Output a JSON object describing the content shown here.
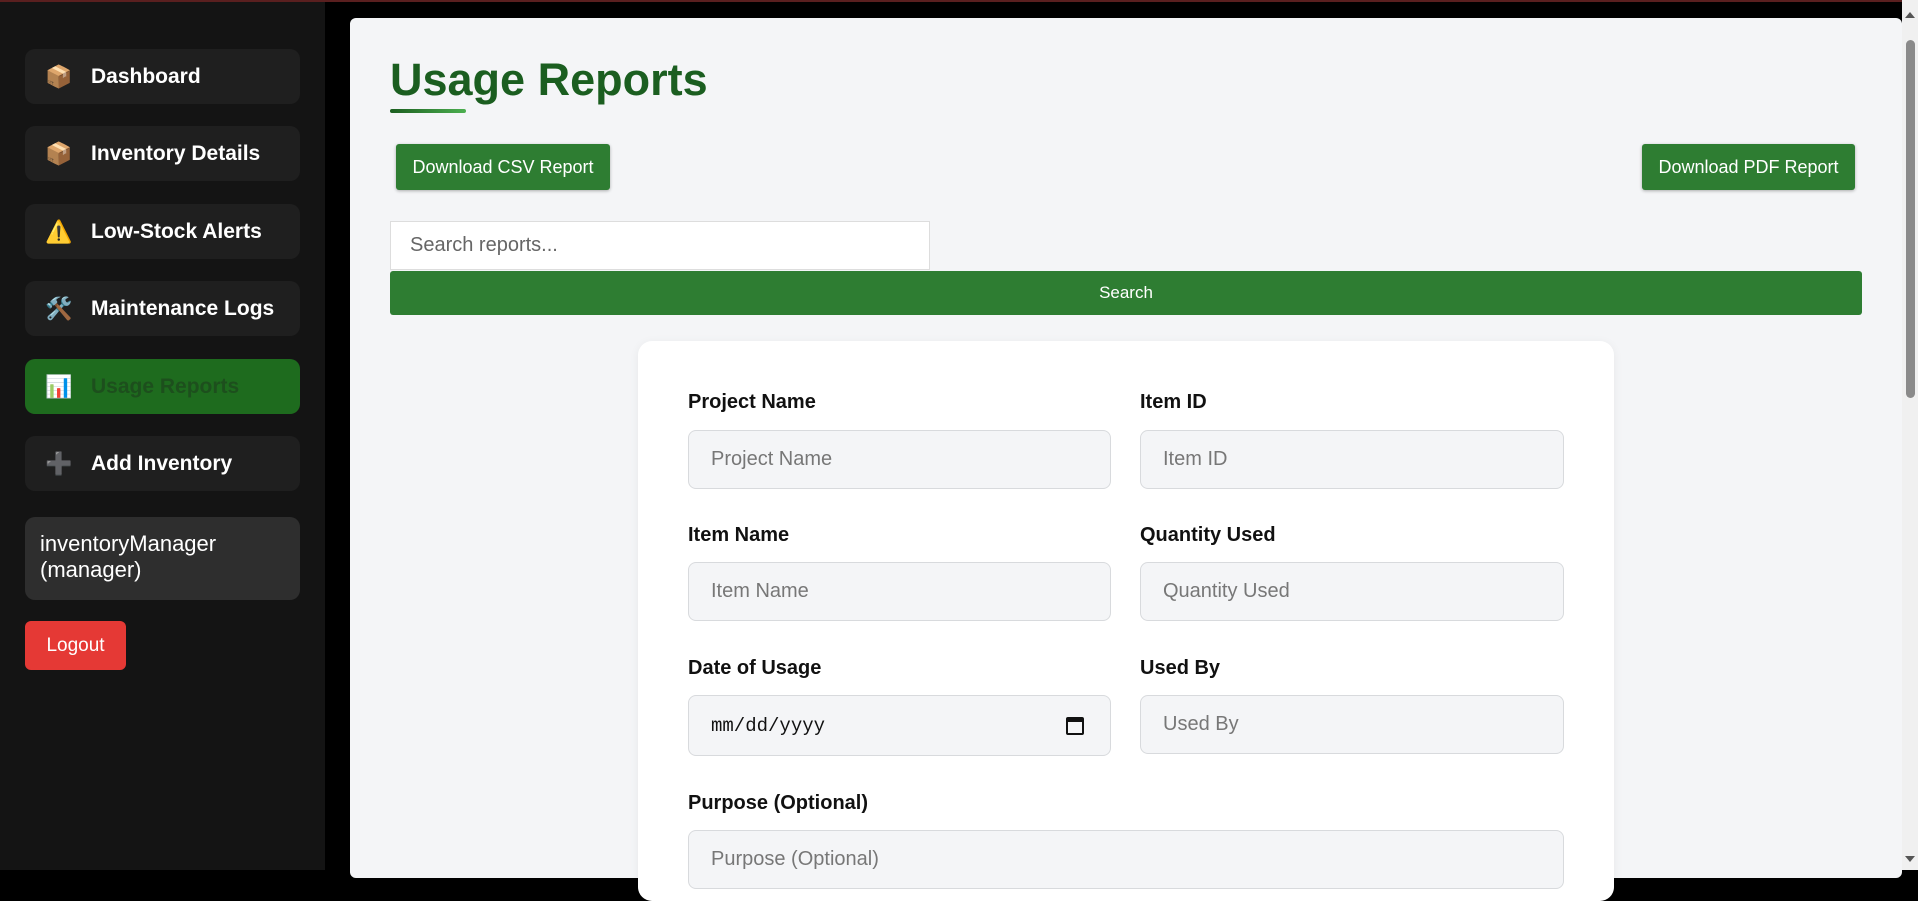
{
  "sidebar": {
    "items": [
      {
        "label": "Dashboard",
        "icon": "📦"
      },
      {
        "label": "Inventory Details",
        "icon": "📦"
      },
      {
        "label": "Low-Stock Alerts",
        "icon": "⚠️"
      },
      {
        "label": "Maintenance Logs",
        "icon": "🛠️"
      },
      {
        "label": "Usage Reports",
        "icon": "📊"
      },
      {
        "label": "Add Inventory",
        "icon": "➕"
      }
    ],
    "user_line1": "inventoryManager",
    "user_line2": "(manager)",
    "logout_label": "Logout"
  },
  "main": {
    "title": "Usage Reports",
    "download_csv_label": "Download CSV Report",
    "download_pdf_label": "Download PDF Report",
    "search_placeholder": "Search reports...",
    "search_button_label": "Search"
  },
  "form": {
    "project_name": {
      "label": "Project Name",
      "placeholder": "Project Name"
    },
    "item_id": {
      "label": "Item ID",
      "placeholder": "Item ID"
    },
    "item_name": {
      "label": "Item Name",
      "placeholder": "Item Name"
    },
    "quantity_used": {
      "label": "Quantity Used",
      "placeholder": "Quantity Used"
    },
    "date_of_usage": {
      "label": "Date of Usage",
      "value": "mm/dd/yyyy"
    },
    "used_by": {
      "label": "Used By",
      "placeholder": "Used By"
    },
    "purpose": {
      "label": "Purpose (Optional)",
      "placeholder": "Purpose (Optional)"
    }
  },
  "colors": {
    "accent": "#2e7d32",
    "title": "#1b5e20",
    "logout": "#e53935"
  }
}
